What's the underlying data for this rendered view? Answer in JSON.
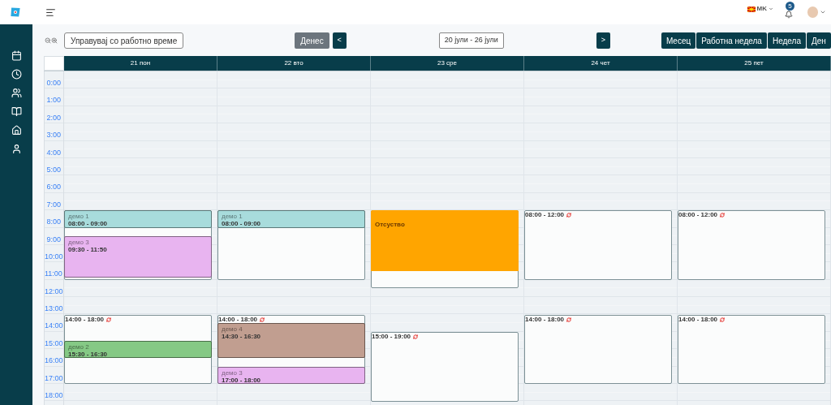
{
  "header": {
    "language": "MK",
    "notifications": "5"
  },
  "toolbar": {
    "manage_button": "Управувај со работно време",
    "today_button": "Денес",
    "prev_button": "<",
    "date_range": "20 јули - 26 јули",
    "next_button": ">",
    "views": [
      "Месец",
      "Работна недела",
      "Недела",
      "Ден"
    ]
  },
  "calendar": {
    "hours": [
      "0:00",
      "1:00",
      "2:00",
      "3:00",
      "4:00",
      "5:00",
      "6:00",
      "7:00",
      "8:00",
      "9:00",
      "10:00",
      "11:00",
      "12:00",
      "13:00",
      "14:00",
      "15:00",
      "16:00",
      "17:00",
      "18:00"
    ],
    "days": [
      {
        "label": "21 пон",
        "shifts": [
          {
            "events": [
              {
                "kind": "event",
                "title": "демо 1",
                "time": "08:00 - 09:00",
                "color": "#a8dcdc"
              },
              {
                "kind": "event",
                "title": "демо 3",
                "time": "09:30 - 11:50",
                "color": "#e8b4f0"
              }
            ]
          },
          {
            "label": "14:00 - 18:00",
            "events": [
              {
                "kind": "event",
                "title": "демо 2",
                "time": "15:30 - 16:30",
                "color": "#85c985"
              }
            ]
          }
        ]
      },
      {
        "label": "22 вто",
        "shifts": [
          {
            "events": [
              {
                "kind": "event",
                "title": "демо 1",
                "time": "08:00 - 09:00",
                "color": "#a8dcdc"
              }
            ]
          },
          {
            "label": "14:00 - 18:00",
            "events": [
              {
                "kind": "event",
                "title": "демо 4",
                "time": "14:30 - 16:30",
                "color": "#c19e90"
              },
              {
                "kind": "event",
                "title": "демо 3",
                "time": "17:00 - 18:00",
                "color": "#e8b4f0"
              }
            ]
          }
        ]
      },
      {
        "label": "23 сре",
        "shifts": [
          {
            "events": [
              {
                "kind": "absence",
                "title": "Отсуство",
                "color": "#ffa500"
              }
            ]
          },
          {
            "label": "15:00 - 19:00"
          }
        ]
      },
      {
        "label": "24 чет",
        "shifts": [
          {
            "label": "08:00 - 12:00"
          },
          {
            "label": "14:00 - 18:00"
          }
        ]
      },
      {
        "label": "25 пет",
        "shifts": [
          {
            "label": "08:00 - 12:00"
          },
          {
            "label": "14:00 - 18:00"
          }
        ]
      }
    ]
  }
}
